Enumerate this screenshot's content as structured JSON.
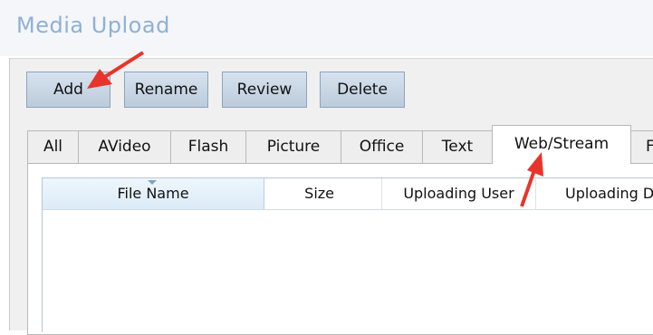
{
  "window": {
    "title": "Media Upload"
  },
  "toolbar": {
    "add_label": "Add",
    "rename_label": "Rename",
    "review_label": "Review",
    "delete_label": "Delete"
  },
  "tabs": [
    {
      "label": "All"
    },
    {
      "label": "AVideo"
    },
    {
      "label": "Flash"
    },
    {
      "label": "Picture"
    },
    {
      "label": "Office"
    },
    {
      "label": "Text"
    },
    {
      "label": "Web/Stream",
      "active": true
    },
    {
      "label": "F"
    }
  ],
  "table": {
    "columns": [
      "File Name",
      "Size",
      "Uploading User",
      "Uploading D"
    ],
    "sorted_column": "File Name",
    "rows": []
  },
  "annotations": {
    "arrow_color": "#e8342a"
  },
  "colors": {
    "title": "#8fb0d3",
    "button_fill": "#c9d6e3",
    "button_border": "#8aa4bf"
  }
}
